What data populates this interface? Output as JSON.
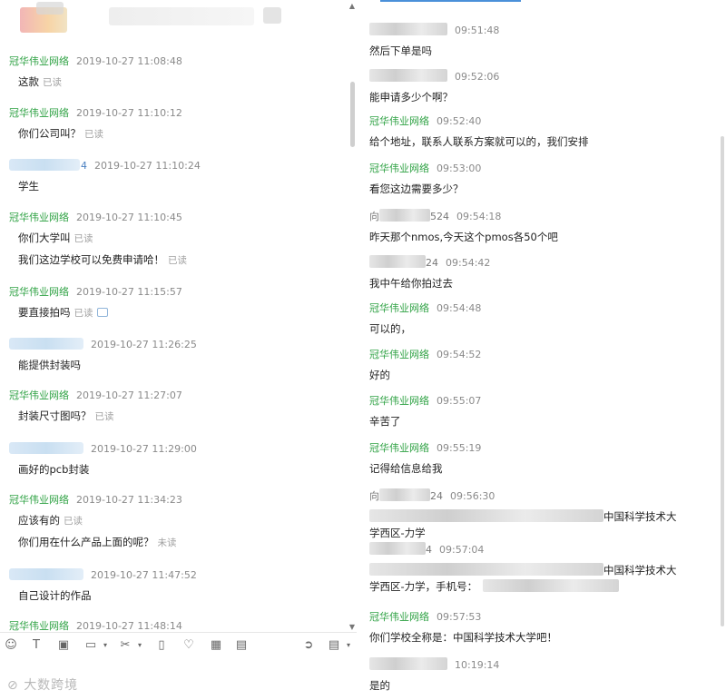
{
  "left": {
    "messages": [
      {
        "sender": "冠华伟业网络",
        "time": "2019-10-27 11:08:48",
        "lines": [
          {
            "text": "这款",
            "status": "已读"
          }
        ]
      },
      {
        "sender": "冠华伟业网络",
        "time": "2019-10-27 11:10:12",
        "lines": [
          {
            "text": "你们公司叫？",
            "status": "已读"
          }
        ]
      },
      {
        "sender": "4",
        "time": "2019-10-27 11:10:24",
        "lines": [
          {
            "text": "学生",
            "status": ""
          }
        ]
      },
      {
        "sender": "冠华伟业网络",
        "time": "2019-10-27 11:10:45",
        "lines": [
          {
            "text": "你们大学叫",
            "status": "已读"
          },
          {
            "text": "我们这边学校可以免费申请哈！",
            "status": "已读"
          }
        ]
      },
      {
        "sender": "冠华伟业网络",
        "time": "2019-10-27 11:15:57",
        "lines": [
          {
            "text": "要直接拍吗",
            "status": "已读"
          }
        ]
      },
      {
        "sender": "",
        "time": "2019-10-27 11:26:25",
        "lines": [
          {
            "text": "能提供封装吗",
            "status": ""
          }
        ]
      },
      {
        "sender": "冠华伟业网络",
        "time": "2019-10-27 11:27:07",
        "lines": [
          {
            "text": "封装尺寸图吗？",
            "status": "已读"
          }
        ]
      },
      {
        "sender": "",
        "time": "2019-10-27 11:29:00",
        "lines": [
          {
            "text": "画好的pcb封装",
            "status": ""
          }
        ]
      },
      {
        "sender": "冠华伟业网络",
        "time": "2019-10-27 11:34:23",
        "lines": [
          {
            "text": "应该有的",
            "status": "已读"
          },
          {
            "text": "你们用在什么产品上面的呢？",
            "status": "未读"
          }
        ]
      },
      {
        "sender": "",
        "time": "2019-10-27 11:47:52",
        "lines": [
          {
            "text": "自己设计的作品",
            "status": ""
          }
        ]
      },
      {
        "sender": "冠华伟业网络",
        "time": "2019-10-27 11:48:14",
        "lines": []
      }
    ]
  },
  "right": {
    "messages": [
      {
        "sender": "",
        "time": "09:51:48",
        "text": "然后下单是吗"
      },
      {
        "sender": "",
        "time": "09:52:06",
        "text": "能申请多少个啊？"
      },
      {
        "sender": "冠华伟业网络",
        "time": "09:52:40",
        "text": "给个地址，联系人联系方案就可以的，我们安排"
      },
      {
        "sender": "冠华伟业网络",
        "time": "09:53:00",
        "text": "看您这边需要多少？"
      },
      {
        "sender": "向",
        "sender_suffix": "524",
        "time": "09:54:18",
        "text": "昨天那个nmos,今天这个pmos各50个吧"
      },
      {
        "sender": "",
        "sender_suffix": "24",
        "time": "09:54:42",
        "text": "我中午给你拍过去"
      },
      {
        "sender": "冠华伟业网络",
        "time": "09:54:48",
        "text": "可以的，"
      },
      {
        "sender": "冠华伟业网络",
        "time": "09:54:52",
        "text": "好的"
      },
      {
        "sender": "冠华伟业网络",
        "time": "09:55:07",
        "text": "辛苦了"
      },
      {
        "sender": "冠华伟业网络",
        "time": "09:55:19",
        "text": "记得给信息给我"
      },
      {
        "sender": "向",
        "sender_suffix": "24",
        "time": "09:56:30",
        "text_end": "中国科学技术大",
        "text2": "学西区-力学"
      },
      {
        "sender": "",
        "sender_suffix": "4",
        "time": "09:57:04",
        "text_end": "中国科学技术大",
        "text2": "学西区-力学，手机号："
      },
      {
        "sender": "冠华伟业网络",
        "time": "09:57:53",
        "text": "你们学校全称是：中国科学技术大学吧！"
      },
      {
        "sender": "",
        "time": "10:19:14",
        "text": "是的"
      }
    ]
  },
  "toolbar": {
    "icons": [
      "emoji-icon",
      "text-format-icon",
      "screenshot-icon",
      "folder-icon",
      "scissors-icon",
      "vibrate-icon",
      "heart-icon",
      "calculator-icon",
      "gift-icon",
      "reply-icon",
      "history-icon"
    ]
  },
  "watermark": "大数跨境",
  "colors": {
    "sender": "#2fa244",
    "time": "#8a8a8a",
    "read": "#a0a0a0"
  }
}
